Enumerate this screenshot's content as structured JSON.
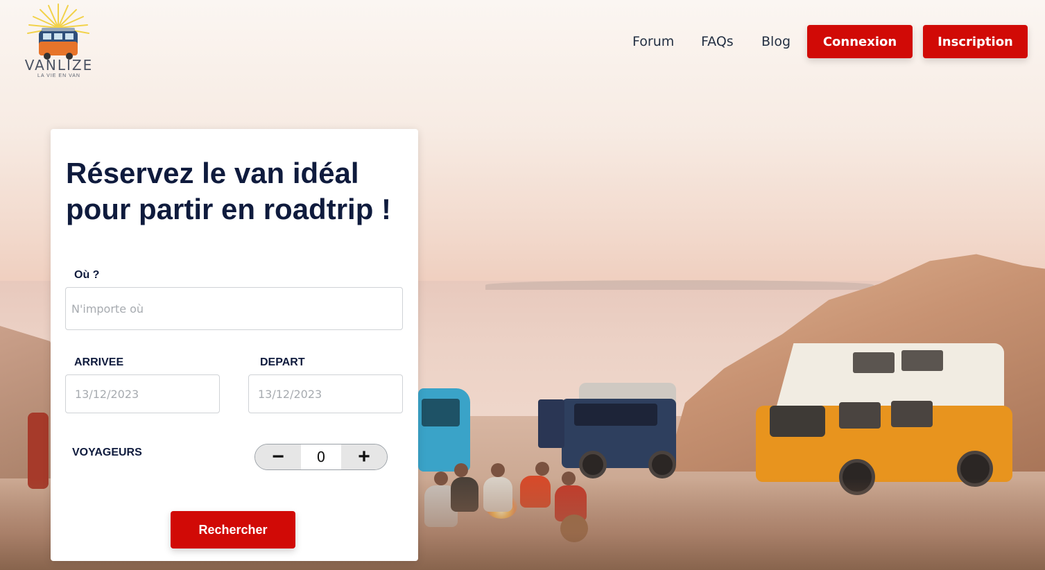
{
  "brand": {
    "name": "VANLIZE",
    "tagline": "LA VIE EN VAN"
  },
  "nav": {
    "links": [
      "Forum",
      "FAQs",
      "Blog"
    ],
    "login_label": "Connexion",
    "signup_label": "Inscription"
  },
  "search": {
    "title_line1": "Réservez le van idéal",
    "title_line2": "pour partir en roadtrip !",
    "where_label": "Où ?",
    "where_placeholder": "N'importe où",
    "arrival_label": "ARRIVEE",
    "arrival_placeholder": "13/12/2023",
    "departure_label": "DEPART",
    "departure_placeholder": "13/12/2023",
    "travelers_label": "VOYAGEURS",
    "travelers_count": "0",
    "decrement_symbol": "−",
    "increment_symbol": "+",
    "submit_label": "Rechercher"
  },
  "colors": {
    "accent": "#d10a06",
    "title_text": "#0f1b3d"
  },
  "icons": {
    "logo": "van-with-sun-logo"
  }
}
